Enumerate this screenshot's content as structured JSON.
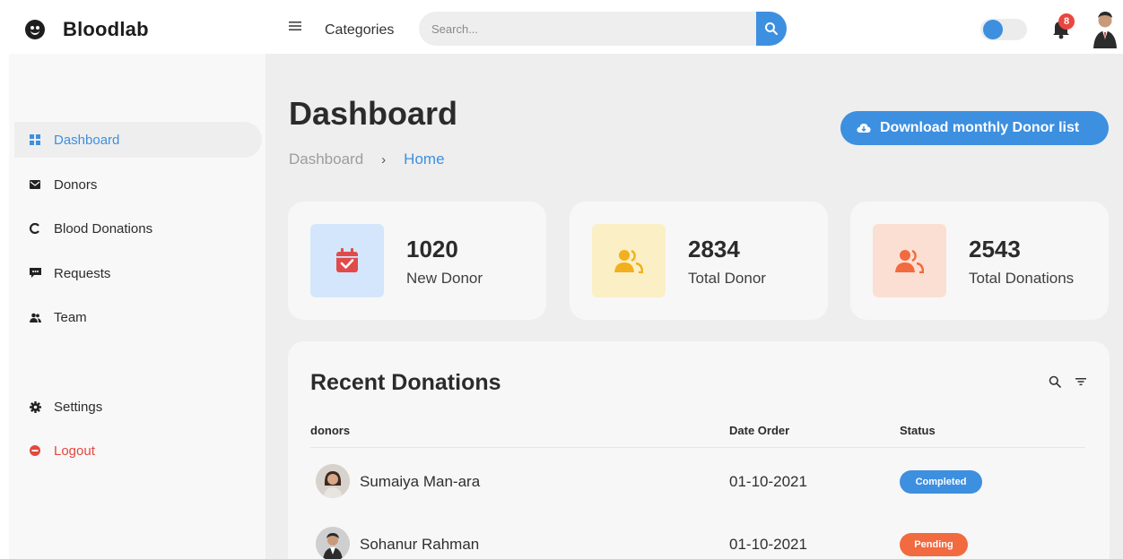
{
  "topbar": {
    "brand": "Bloodlab",
    "categories_label": "Categories",
    "search_placeholder": "Search...",
    "notification_count": "8"
  },
  "sidebar": {
    "items": [
      {
        "label": "Dashboard",
        "icon": "grid-icon",
        "active": true
      },
      {
        "label": "Donors",
        "icon": "envelope-icon"
      },
      {
        "label": "Blood Donations",
        "icon": "refresh-icon"
      },
      {
        "label": "Requests",
        "icon": "chat-icon"
      },
      {
        "label": "Team",
        "icon": "team-icon"
      }
    ],
    "settings_label": "Settings",
    "logout_label": "Logout"
  },
  "main": {
    "title": "Dashboard",
    "breadcrumb": [
      "Dashboard",
      "Home"
    ],
    "download_label": "Download monthly Donor list",
    "stats": [
      {
        "value": "1020",
        "label": "New Donor",
        "icon": "calendar-check-icon",
        "bg": "#d3e6fb",
        "color": "#e14a4a"
      },
      {
        "value": "2834",
        "label": "Total Donor",
        "icon": "users-icon",
        "bg": "#fbefc6",
        "color": "#f2b01e"
      },
      {
        "value": "2543",
        "label": "Total Donations",
        "icon": "users-icon",
        "bg": "#fcdfd3",
        "color": "#f26a3f"
      }
    ],
    "recent": {
      "title": "Recent Donations",
      "columns": [
        "donors",
        "Date Order",
        "Status"
      ],
      "rows": [
        {
          "name": "Sumaiya Man-ara",
          "date": "01-10-2021",
          "status": "Completed",
          "status_color": "#3d8fe0"
        },
        {
          "name": "Sohanur Rahman",
          "date": "01-10-2021",
          "status": "Pending",
          "status_color": "#f26a3f"
        }
      ]
    }
  },
  "colors": {
    "accent": "#3d8fe0",
    "danger": "#e2483f",
    "page_bg": "#eeeeee",
    "sidebar_bg": "#f8f8f8"
  }
}
